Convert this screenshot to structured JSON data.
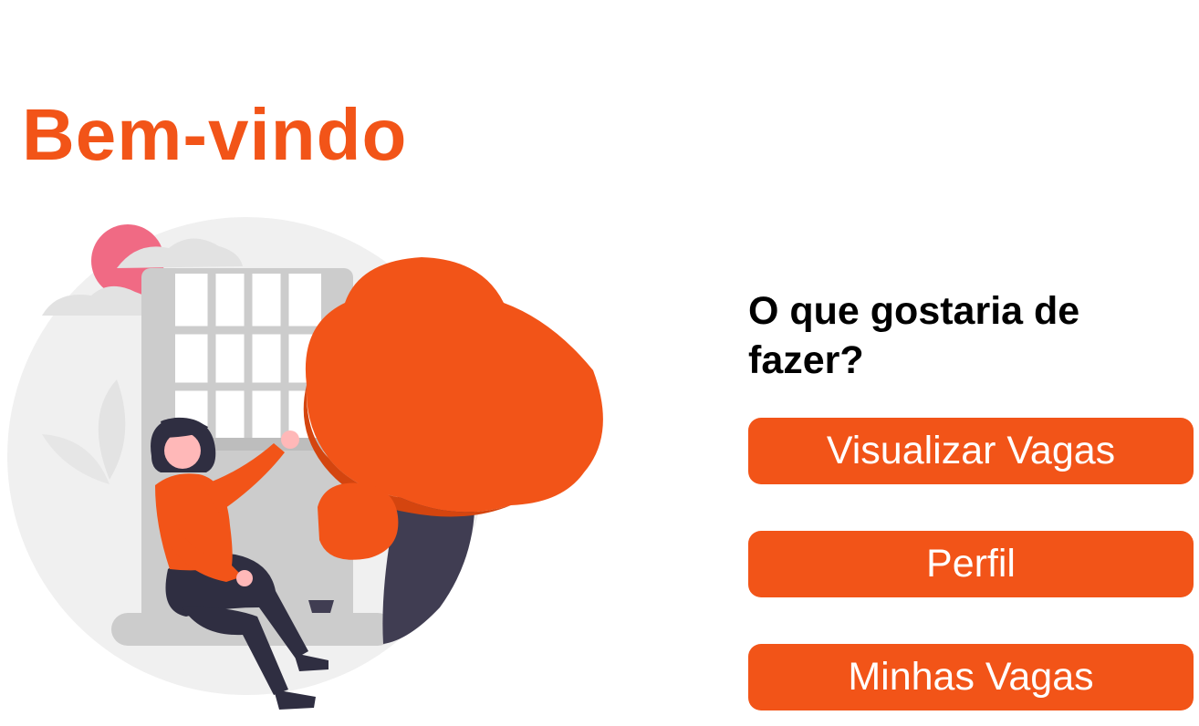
{
  "header": {
    "title": "Bem-vindo"
  },
  "main": {
    "question": "O que gostaria de fazer?",
    "actions": [
      {
        "label": "Visualizar Vagas"
      },
      {
        "label": "Perfil"
      },
      {
        "label": "Minhas Vagas"
      }
    ]
  },
  "illustration": {
    "subject": "woman-sitting-by-window-illustration"
  },
  "colors": {
    "accent": "#F25418",
    "accent_dark": "#D4450F",
    "sun": "#F06A84",
    "backdrop": "#F0F0F0",
    "window_frame": "#CCCCCC",
    "trunk": "#403D52",
    "clothing_dark": "#2F2E41",
    "skin": "#FFB8B8",
    "text": "#000000",
    "button_text": "#FFFFFF"
  }
}
